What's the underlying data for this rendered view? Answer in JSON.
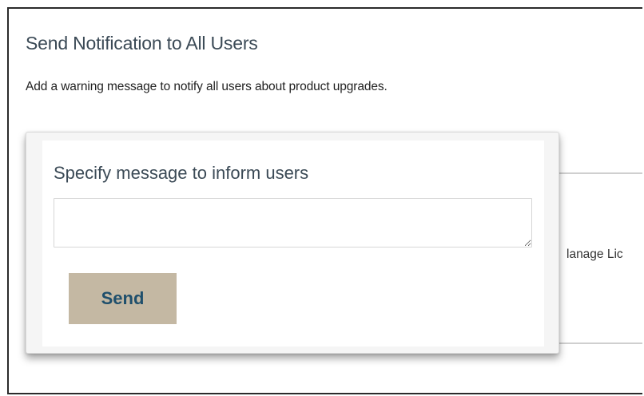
{
  "header": {
    "title": "Send Notification to All Users",
    "description": "Add a warning message to notify all users about product upgrades."
  },
  "background": {
    "partial_link_text": "lanage Lic"
  },
  "popup": {
    "label": "Specify message to inform users",
    "message_value": "",
    "message_placeholder": "",
    "send_label": "Send"
  },
  "colors": {
    "title_text": "#3b4a56",
    "send_button_bg": "#c4b8a3",
    "send_button_text": "#1f4f6c"
  }
}
